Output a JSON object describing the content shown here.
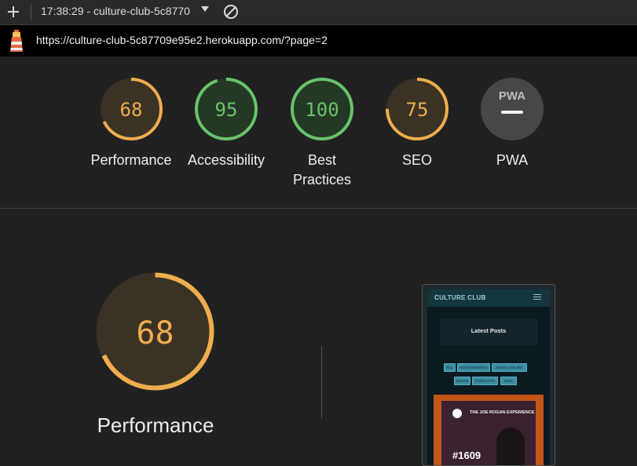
{
  "toolbar": {
    "report_label": "17:38:29 - culture-club-5c8770",
    "icons": [
      "plus-icon",
      "chevron-down-icon",
      "block-icon"
    ]
  },
  "urlbar": {
    "url": "https://culture-club-5c87709e95e2.herokuapp.com/?page=2",
    "icon": "lighthouse-icon"
  },
  "gauges": [
    {
      "label": "Performance",
      "score": "68",
      "color": "#f0ad4e",
      "fill": 0.68
    },
    {
      "label": "Accessibility",
      "score": "95",
      "color": "#68c46a",
      "fill": 0.95
    },
    {
      "label": "Best Practices",
      "score": "100",
      "color": "#68c46a",
      "fill": 1.0
    },
    {
      "label": "SEO",
      "score": "75",
      "color": "#f0ad4e",
      "fill": 0.75
    },
    {
      "label": "PWA",
      "badge": "PWA"
    }
  ],
  "focus": {
    "label": "Performance",
    "score": "68",
    "color": "#f0ad4e",
    "fill": 0.68
  },
  "screenshot": {
    "brand": "CULTURE CLUB",
    "heading": "Latest Posts",
    "filters_row1": [
      "ALL",
      "MOVIES/SERIES",
      "MUSIC ALBUMS"
    ],
    "filters_row2": [
      "BOOKS",
      "PODCASTS",
      "MISC"
    ],
    "card_title": "THE JOE ROGAN EXPERIENCE",
    "card_episode": "#1609"
  }
}
